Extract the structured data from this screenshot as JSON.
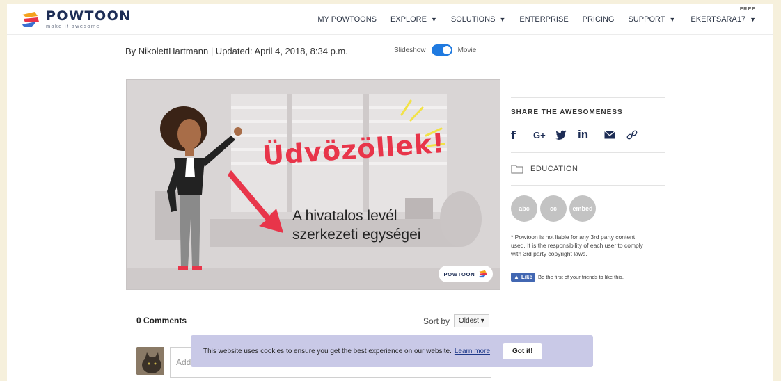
{
  "header": {
    "logo_word": "POWTOON",
    "logo_tagline": "make it awesome",
    "nav": [
      {
        "label": "MY POWTOONS",
        "caret": ""
      },
      {
        "label": "EXPLORE",
        "caret": "▼"
      },
      {
        "label": "SOLUTIONS",
        "caret": "▼"
      },
      {
        "label": "ENTERPRISE",
        "caret": ""
      },
      {
        "label": "PRICING",
        "caret": ""
      },
      {
        "label": "SUPPORT",
        "caret": "▼"
      }
    ],
    "user": {
      "label": "EKERTSARA17",
      "caret": "▼",
      "plan": "FREE"
    }
  },
  "byline": {
    "text": "By NikolettHartmann | Updated: April 4, 2018, 8:34 p.m."
  },
  "view_toggle": {
    "left": "Slideshow",
    "right": "Movie",
    "active": "Movie"
  },
  "video": {
    "greeting": "Üdvözöllek!",
    "caption_line1": "A hivatalos levél",
    "caption_line2": "szerkezeti egységei",
    "badge": "POWTOON"
  },
  "sidebar": {
    "share_title": "SHARE THE AWESOMENESS",
    "share_icons": [
      "f",
      "G+",
      "twitter-icon",
      "in",
      "mail-icon",
      "link-icon"
    ],
    "category": "EDUCATION",
    "license_badges": [
      "abc",
      "cc",
      "embed"
    ],
    "disclaimer": "* Powtoon is not liable for any 3rd party content used. It is the responsibility of each user to comply with 3rd party copyright laws.",
    "fb_like": "Like",
    "fb_text": "Be the first of your friends to like this."
  },
  "comments": {
    "count_label": "0 Comments",
    "sort_label": "Sort by",
    "sort_value": "Oldest ▾",
    "placeholder": "Add"
  },
  "cookie": {
    "text": "This website uses cookies to ensure you get the best experience on our website.",
    "link": "Learn more",
    "button": "Got it!"
  },
  "colors": {
    "accent_red": "#e8354a",
    "toggle_blue": "#1f7ae0",
    "logo_navy": "#1d2d55",
    "cookie_bg": "#c9c9e7"
  }
}
